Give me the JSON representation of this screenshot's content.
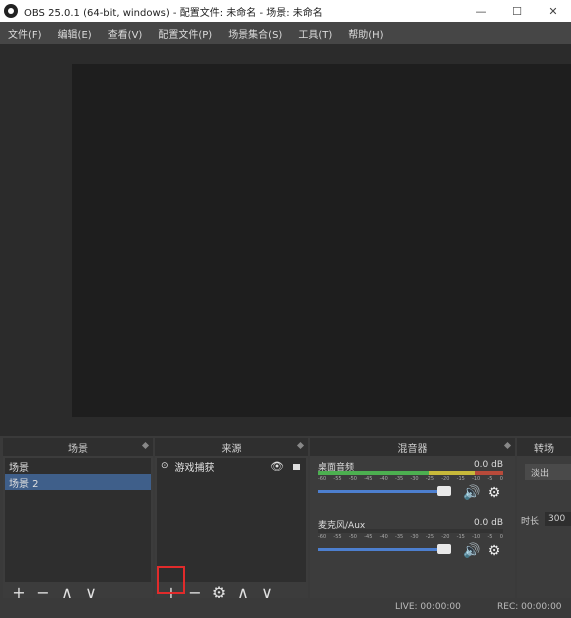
{
  "titlebar": {
    "title": "OBS 25.0.1 (64-bit, windows) - 配置文件: 未命名 - 场景: 未命名"
  },
  "menu": [
    "文件(F)",
    "编辑(E)",
    "查看(V)",
    "配置文件(P)",
    "场景集合(S)",
    "工具(T)",
    "帮助(H)"
  ],
  "docks": {
    "scenes": {
      "title": "场景",
      "items": [
        "场景",
        "场景 2"
      ]
    },
    "sources": {
      "title": "来源",
      "items": [
        {
          "label": "游戏捕获"
        }
      ]
    },
    "mixer": {
      "title": "混音器",
      "channels": [
        {
          "name": "桌面音频",
          "db": "0.0 dB",
          "level": 0.85
        },
        {
          "name": "麦克风/Aux",
          "db": "0.0 dB",
          "level": 0
        }
      ],
      "ticks": [
        "-60",
        "-55",
        "-50",
        "-45",
        "-40",
        "-35",
        "-30",
        "-25",
        "-20",
        "-15",
        "-10",
        "-5",
        "0"
      ]
    },
    "transitions": {
      "title": "转场",
      "fade": "淡出",
      "duration_label": "时长",
      "duration_value": "300"
    }
  },
  "status": {
    "live": "LIVE: 00:00:00",
    "rec": "REC: 00:00:00"
  },
  "colors": {
    "highlight": "#e12b2b",
    "selected": "#3f5f8a",
    "meter_green": "#4caf50"
  }
}
